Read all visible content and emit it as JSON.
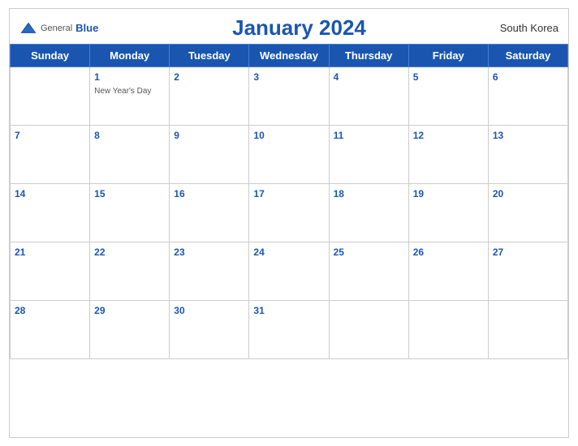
{
  "header": {
    "logo_general": "General",
    "logo_blue": "Blue",
    "title": "January 2024",
    "country": "South Korea"
  },
  "weekdays": [
    "Sunday",
    "Monday",
    "Tuesday",
    "Wednesday",
    "Thursday",
    "Friday",
    "Saturday"
  ],
  "weeks": [
    [
      {
        "day": "",
        "empty": true
      },
      {
        "day": "1",
        "holiday": "New Year's Day"
      },
      {
        "day": "2",
        "holiday": ""
      },
      {
        "day": "3",
        "holiday": ""
      },
      {
        "day": "4",
        "holiday": ""
      },
      {
        "day": "5",
        "holiday": ""
      },
      {
        "day": "6",
        "holiday": ""
      }
    ],
    [
      {
        "day": "7",
        "holiday": ""
      },
      {
        "day": "8",
        "holiday": ""
      },
      {
        "day": "9",
        "holiday": ""
      },
      {
        "day": "10",
        "holiday": ""
      },
      {
        "day": "11",
        "holiday": ""
      },
      {
        "day": "12",
        "holiday": ""
      },
      {
        "day": "13",
        "holiday": ""
      }
    ],
    [
      {
        "day": "14",
        "holiday": ""
      },
      {
        "day": "15",
        "holiday": ""
      },
      {
        "day": "16",
        "holiday": ""
      },
      {
        "day": "17",
        "holiday": ""
      },
      {
        "day": "18",
        "holiday": ""
      },
      {
        "day": "19",
        "holiday": ""
      },
      {
        "day": "20",
        "holiday": ""
      }
    ],
    [
      {
        "day": "21",
        "holiday": ""
      },
      {
        "day": "22",
        "holiday": ""
      },
      {
        "day": "23",
        "holiday": ""
      },
      {
        "day": "24",
        "holiday": ""
      },
      {
        "day": "25",
        "holiday": ""
      },
      {
        "day": "26",
        "holiday": ""
      },
      {
        "day": "27",
        "holiday": ""
      }
    ],
    [
      {
        "day": "28",
        "holiday": ""
      },
      {
        "day": "29",
        "holiday": ""
      },
      {
        "day": "30",
        "holiday": ""
      },
      {
        "day": "31",
        "holiday": ""
      },
      {
        "day": "",
        "empty": true
      },
      {
        "day": "",
        "empty": true
      },
      {
        "day": "",
        "empty": true
      }
    ]
  ],
  "colors": {
    "header_bg": "#1a56b0",
    "header_text": "#ffffff",
    "day_num_color": "#1a56b0"
  }
}
